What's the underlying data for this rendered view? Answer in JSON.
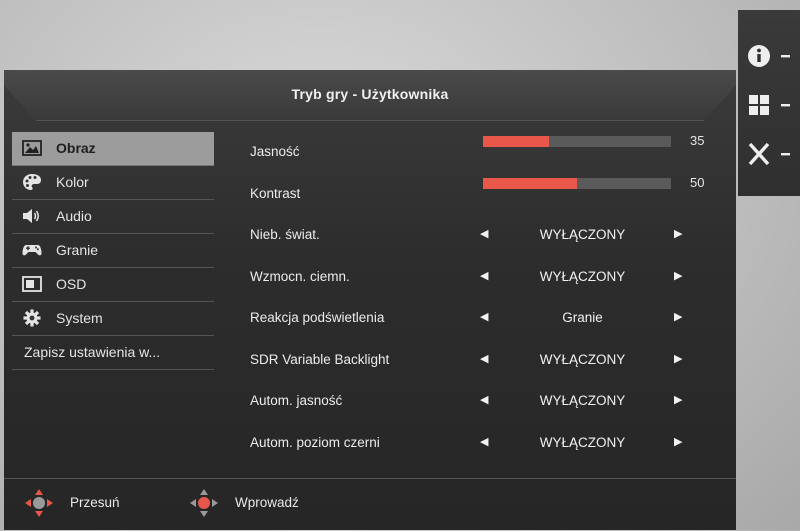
{
  "header": {
    "title": "Tryb gry - Użytkownika"
  },
  "sidebar": {
    "items": [
      {
        "label": "Obraz",
        "icon": "image-icon",
        "active": true
      },
      {
        "label": "Kolor",
        "icon": "palette-icon"
      },
      {
        "label": "Audio",
        "icon": "speaker-icon"
      },
      {
        "label": "Granie",
        "icon": "gamepad-icon"
      },
      {
        "label": "OSD",
        "icon": "osd-icon"
      },
      {
        "label": "System",
        "icon": "gear-icon"
      },
      {
        "label": "Zapisz ustawienia w..."
      }
    ]
  },
  "settings": {
    "jasnosc": {
      "label": "Jasność",
      "value": 35,
      "level_percent": 35
    },
    "kontrast": {
      "label": "Kontrast",
      "value": 50,
      "level_percent": 50
    },
    "options": [
      {
        "label": "Nieb. świat.",
        "value": "WYŁĄCZONY"
      },
      {
        "label": "Wzmocn. ciemn.",
        "value": "WYŁĄCZONY"
      },
      {
        "label": "Reakcja podświetlenia",
        "value": "Granie"
      },
      {
        "label": "SDR Variable Backlight",
        "value": "WYŁĄCZONY"
      },
      {
        "label": "Autom. jasność",
        "value": "WYŁĄCZONY"
      },
      {
        "label": "Autom. poziom czerni",
        "value": "WYŁĄCZONY"
      }
    ]
  },
  "footer": {
    "move_label": "Przesuń",
    "enter_label": "Wprowadź"
  },
  "side_panel": {
    "buttons": [
      "info-icon",
      "menu-grid-icon",
      "close-icon"
    ]
  },
  "colors": {
    "accent": "#e8574a",
    "active_bg": "#9c9c9c",
    "osd_bg": "#2d2d2d"
  }
}
